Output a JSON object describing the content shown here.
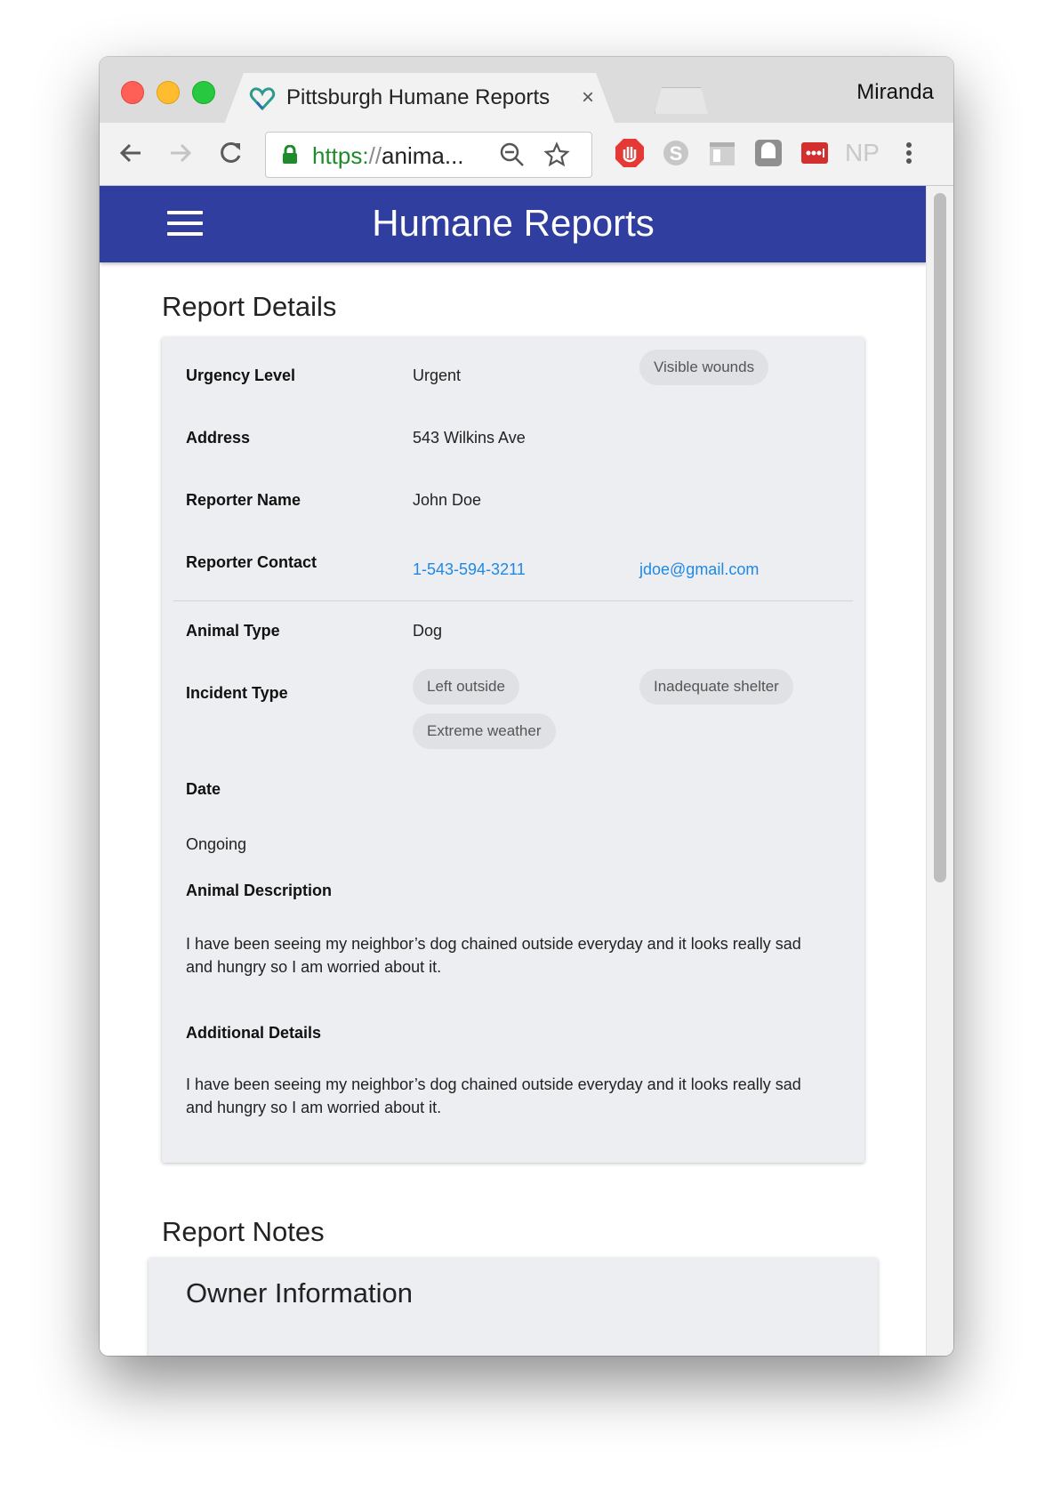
{
  "browser": {
    "tab_title": "Pittsburgh Humane Reports",
    "close_glyph": "×",
    "profile_name": "Miranda",
    "url_scheme": "https:",
    "url_slashes": "//",
    "url_rest": "anima...",
    "extensions": [
      "adblock-icon",
      "skype-icon",
      "reader-icon",
      "ghostery-icon",
      "lastpass-icon",
      "np-icon"
    ],
    "np_label": "NP"
  },
  "appbar": {
    "title": "Humane Reports"
  },
  "report_details": {
    "section_title": "Report Details",
    "urgency_label": "Urgency Level",
    "urgency_value": "Urgent",
    "urgency_chip": "Visible wounds",
    "address_label": "Address",
    "address_value": "543 Wilkins Ave",
    "reporter_name_label": "Reporter Name",
    "reporter_name_value": "John Doe",
    "reporter_contact_label": "Reporter Contact",
    "reporter_phone": "1-543-594-3211",
    "reporter_email": "jdoe@gmail.com",
    "animal_type_label": "Animal Type",
    "animal_type_value": "Dog",
    "incident_type_label": "Incident Type",
    "incident_types": [
      "Left outside",
      "Inadequate shelter",
      "Extreme weather"
    ],
    "date_label": "Date",
    "date_value": "Ongoing",
    "animal_description_label": "Animal Description",
    "animal_description": "I have been seeing my neighbor’s dog chained outside everyday and it looks really sad and hungry so I am worried about it.",
    "additional_details_label": "Additional Details",
    "additional_details": "I have been seeing my neighbor’s dog chained outside everyday and it looks really sad and hungry so I am worried about it."
  },
  "report_notes": {
    "section_title": "Report Notes",
    "owner_info_title": "Owner Information"
  },
  "colors": {
    "appbar": "#303f9f",
    "link": "#1e88e5",
    "card_bg": "#eceef1",
    "chip_bg": "#dfe1e4"
  }
}
